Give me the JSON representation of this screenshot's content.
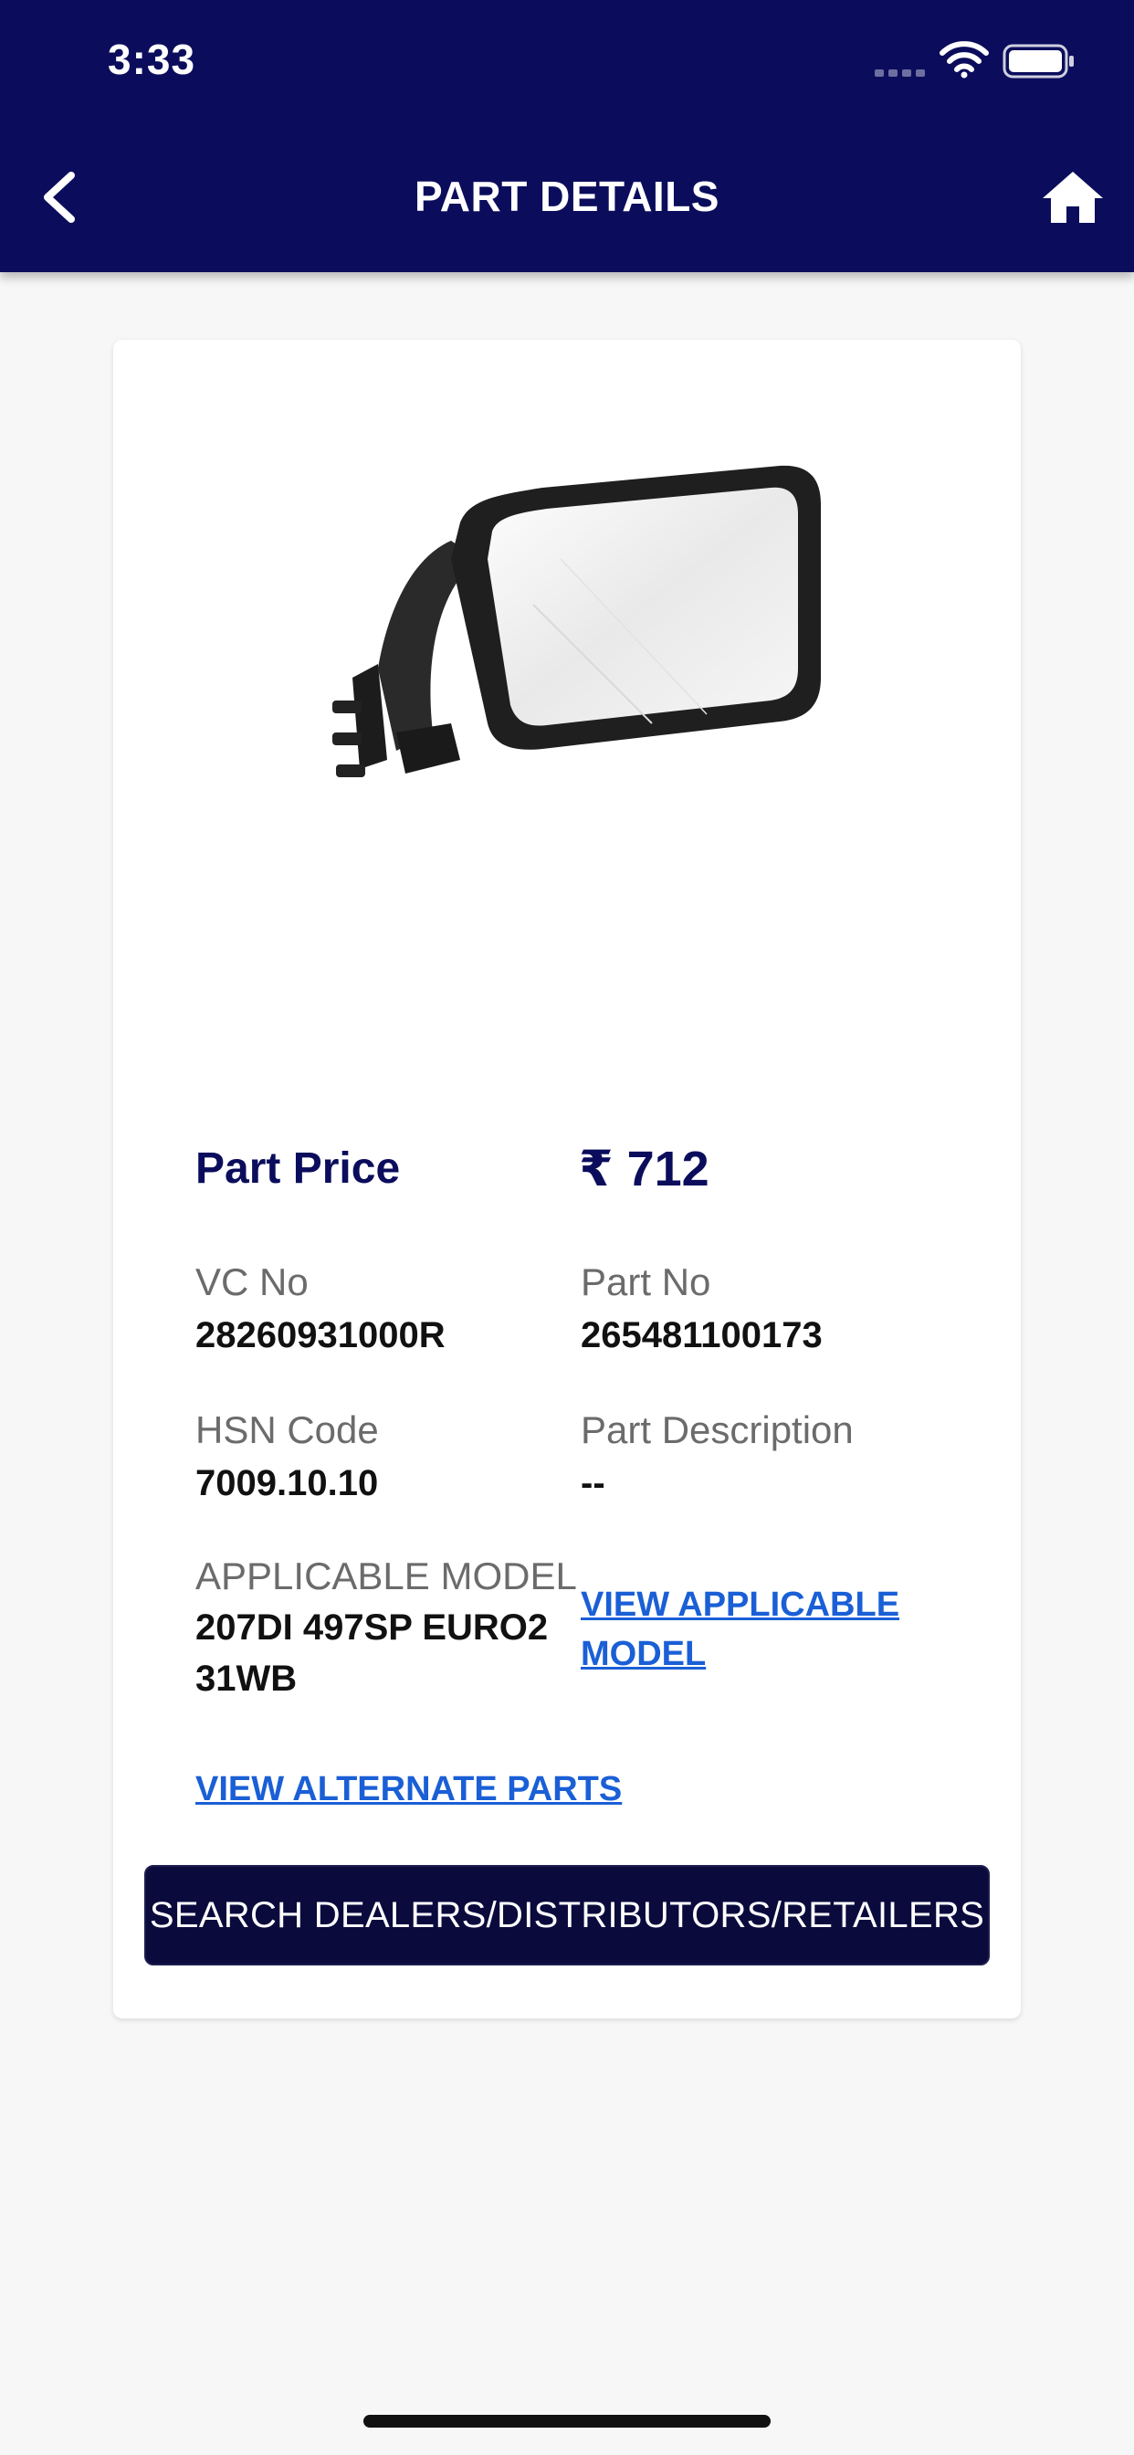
{
  "status_bar": {
    "time": "3:33"
  },
  "header": {
    "title": "PART DETAILS"
  },
  "colors": {
    "primary": "#0b0d5c",
    "link": "#1a5fd6",
    "button": "#0a0a3d",
    "background": "#f7f7f7"
  },
  "icons": {
    "back": "chevron-left-icon",
    "home": "home-icon",
    "signal": "cellular-signal-icon",
    "wifi": "wifi-icon",
    "battery": "battery-icon"
  },
  "part": {
    "price_label": "Part Price",
    "price_value": "₹ 712",
    "vc_no_label": "VC No",
    "vc_no_value": "28260931000R",
    "part_no_label": "Part No",
    "part_no_value": "265481100173",
    "hsn_label": "HSN Code",
    "hsn_value": "7009.10.10",
    "description_label": "Part Description",
    "description_value": "--",
    "applicable_model_label": "APPLICABLE MODEL",
    "applicable_model_value": "207DI 497SP EURO2 31WB",
    "view_applicable_model_link": "VIEW APPLICABLE MODEL",
    "view_alternate_parts_link": "VIEW  ALTERNATE PARTS"
  },
  "actions": {
    "search_button": "SEARCH DEALERS/DISTRIBUTORS/RETAILERS"
  }
}
